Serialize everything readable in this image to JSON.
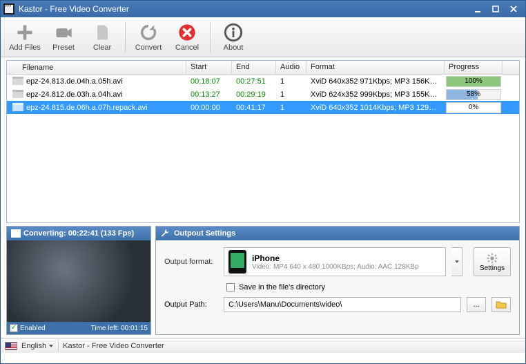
{
  "window": {
    "title": "Kastor - Free Video Converter"
  },
  "toolbar": {
    "addfiles": "Add Files",
    "preset": "Preset",
    "clear": "Clear",
    "convert": "Convert",
    "cancel": "Cancel",
    "about": "About"
  },
  "columns": {
    "filename": "Filename",
    "start": "Start",
    "end": "End",
    "audio": "Audio",
    "format": "Format",
    "progress": "Progress"
  },
  "rows": [
    {
      "filename": "epz-24.813.de.04h.a.05h.avi",
      "start": "00:18:07",
      "end": "00:27:51",
      "audio": "1",
      "format": "XviD 640x352 971Kbps; MP3 156Kbp...",
      "progress": 100,
      "progress_label": "100%",
      "bar": "green",
      "selected": false
    },
    {
      "filename": "epz-24.812.de.03h.a.04h.avi",
      "start": "00:13:27",
      "end": "00:29:19",
      "audio": "1",
      "format": "XviD 624x352 999Kbps; MP3 155Kbp...",
      "progress": 58,
      "progress_label": "58%",
      "bar": "blue",
      "selected": false
    },
    {
      "filename": "epz-24.815.de.06h.a.07h.repack.avi",
      "start": "00:00:00",
      "end": "00:41:17",
      "audio": "1",
      "format": "XviD 640x352 1014Kbps; MP3 129Kb...",
      "progress": 0,
      "progress_label": "0%",
      "bar": "none",
      "selected": true
    }
  ],
  "preview": {
    "title": "Converting: 00:22:41 (133 Fps)",
    "enabled_label": "Enabled",
    "timeleft_label": "Time left: 00:01:15"
  },
  "settings": {
    "panel_title": "Outpout Settings",
    "output_format_label": "Output format:",
    "format_name": "iPhone",
    "format_desc": "Video: MP4 640 x 480 1000KBps; Audio: AAC 128KBp",
    "settings_btn": "Settings",
    "save_in_dir": "Save in the file's directory",
    "output_path_label": "Output Path:",
    "output_path_value": "C:\\Users\\Manu\\Documents\\video\\"
  },
  "status": {
    "language": "English",
    "appname": "Kastor - Free Video Converter"
  }
}
